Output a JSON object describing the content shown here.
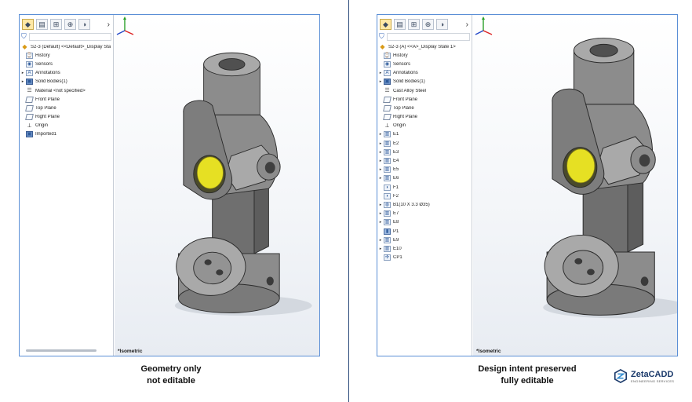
{
  "left_panel": {
    "tabs": [
      "feature-manager-icon",
      "property-manager-icon",
      "configuration-manager-icon",
      "dimxpert-icon",
      "display-manager-icon"
    ],
    "tree": [
      {
        "label": "S2-3 (Default) <<Default>_Display Sta",
        "icon": "part-icon",
        "expandable": false,
        "root": true
      },
      {
        "label": "History",
        "icon": "history-icon",
        "expandable": false
      },
      {
        "label": "Sensors",
        "icon": "sensors-icon",
        "expandable": false
      },
      {
        "label": "Annotations",
        "icon": "annotations-icon",
        "expandable": true
      },
      {
        "label": "Solid Bodies(1)",
        "icon": "solid-bodies-icon",
        "expandable": true
      },
      {
        "label": "Material <not specified>",
        "icon": "material-icon",
        "expandable": false
      },
      {
        "label": "Front Plane",
        "icon": "plane-icon",
        "expandable": false
      },
      {
        "label": "Top Plane",
        "icon": "plane-icon",
        "expandable": false
      },
      {
        "label": "Right Plane",
        "icon": "plane-icon",
        "expandable": false
      },
      {
        "label": "Origin",
        "icon": "origin-icon",
        "expandable": false
      },
      {
        "label": "Imported1",
        "icon": "imported-body-icon",
        "expandable": false
      }
    ],
    "view_label": "*Isometric"
  },
  "right_panel": {
    "tabs": [
      "feature-manager-icon",
      "property-manager-icon",
      "configuration-manager-icon",
      "dimxpert-icon",
      "display-manager-icon"
    ],
    "tree": [
      {
        "label": "S2-3 (A) <<A>_Display State 1>",
        "icon": "part-icon",
        "expandable": false,
        "root": true
      },
      {
        "label": "History",
        "icon": "history-icon",
        "expandable": false
      },
      {
        "label": "Sensors",
        "icon": "sensors-icon",
        "expandable": false
      },
      {
        "label": "Annotations",
        "icon": "annotations-icon",
        "expandable": true
      },
      {
        "label": "Solid Bodies(1)",
        "icon": "solid-bodies-icon",
        "expandable": true
      },
      {
        "label": "Cast Alloy Steel",
        "icon": "material-icon",
        "expandable": false
      },
      {
        "label": "Front Plane",
        "icon": "plane-icon",
        "expandable": false
      },
      {
        "label": "Top Plane",
        "icon": "plane-icon",
        "expandable": false
      },
      {
        "label": "Right Plane",
        "icon": "plane-icon",
        "expandable": false
      },
      {
        "label": "Origin",
        "icon": "origin-icon",
        "expandable": false
      },
      {
        "label": "E1",
        "icon": "extrude-icon",
        "expandable": true
      },
      {
        "label": "E2",
        "icon": "extrude-icon",
        "expandable": true
      },
      {
        "label": "E3",
        "icon": "extrude-icon",
        "expandable": true
      },
      {
        "label": "E4",
        "icon": "extrude-icon",
        "expandable": true
      },
      {
        "label": "E5",
        "icon": "extrude-icon",
        "expandable": true
      },
      {
        "label": "E6",
        "icon": "extrude-icon",
        "expandable": true
      },
      {
        "label": "F1",
        "icon": "fillet-icon",
        "expandable": false
      },
      {
        "label": "F2",
        "icon": "fillet-icon",
        "expandable": false
      },
      {
        "label": "B1(10 X 3.3  Ø35)",
        "icon": "hole-icon",
        "expandable": true
      },
      {
        "label": "E7",
        "icon": "extrude-icon",
        "expandable": true
      },
      {
        "label": "E8",
        "icon": "extrude-icon",
        "expandable": true
      },
      {
        "label": "P1",
        "icon": "sheet-icon",
        "expandable": false
      },
      {
        "label": "E9",
        "icon": "extrude-icon",
        "expandable": true
      },
      {
        "label": "E10",
        "icon": "extrude-icon",
        "expandable": true
      },
      {
        "label": "CP1",
        "icon": "cosmetic-pattern-icon",
        "expandable": false
      }
    ],
    "view_label": "*Isometric"
  },
  "captions": {
    "left_line1": "Geometry only",
    "left_line2": "not editable",
    "right_line1": "Design intent preserved",
    "right_line2": "fully editable"
  },
  "logo": {
    "name": "ZetaCADD",
    "tagline": "ENGINEERING SERVICES"
  },
  "colors": {
    "window_border": "#5b8fd6",
    "divider": "#2a4a7a",
    "part_gray": "#8a8a8a",
    "bore_yellow": "#e6e023",
    "brand_blue": "#1b3a6b"
  }
}
